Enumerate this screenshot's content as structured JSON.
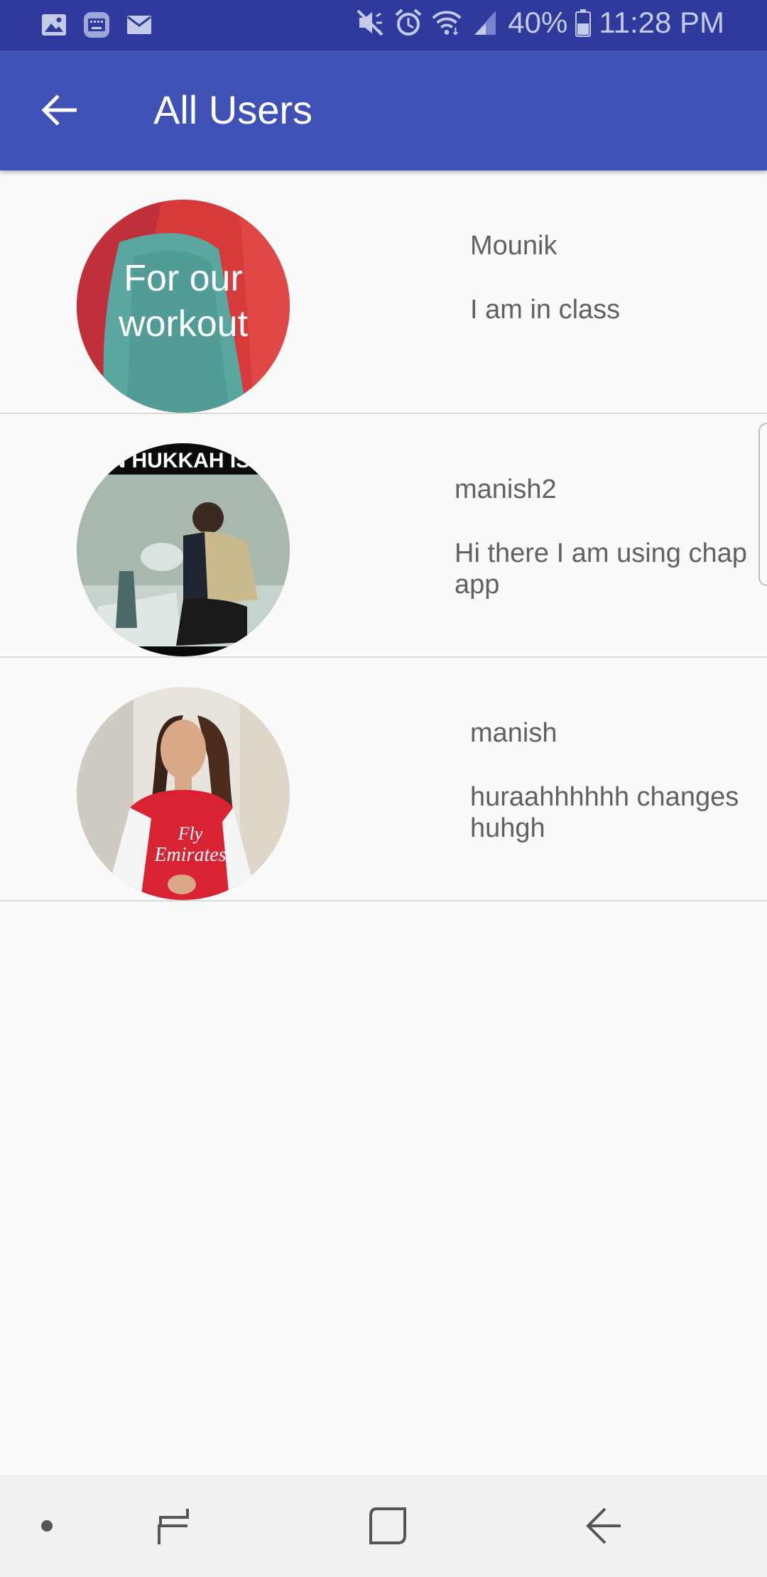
{
  "status_bar": {
    "battery": "40%",
    "time": "11:28 PM",
    "left_icons": [
      "gallery-icon",
      "keyboard-icon",
      "mail-icon"
    ],
    "right_icons": [
      "mute-icon",
      "alarm-icon",
      "wifi-icon",
      "signal-icon",
      "battery-icon"
    ]
  },
  "app_bar": {
    "title": "All Users",
    "back_icon": "arrow-left-icon",
    "background": "#3f51b5"
  },
  "users": [
    {
      "name": "Mounik",
      "status": "I am in class",
      "avatar_caption": "For our workout"
    },
    {
      "name": "manish2",
      "status": "Hi there I am using chap app",
      "avatar_caption": "EN HUKKAH IS E"
    },
    {
      "name": "manish",
      "status": "huraahhhhhh changes huhgh",
      "avatar_caption": "Fly Emirates"
    }
  ],
  "nav_bar": {
    "buttons": [
      "dot-icon",
      "recent-apps-icon",
      "home-icon",
      "back-icon"
    ]
  }
}
